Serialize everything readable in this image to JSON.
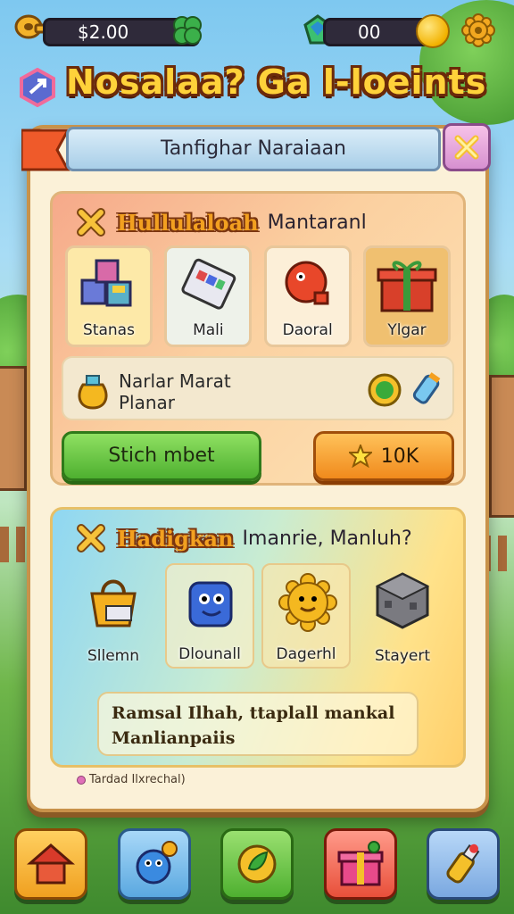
{
  "hud": {
    "currency_left": "$2.00",
    "currency_right": "00",
    "icons": [
      "key-icon",
      "clover-icon",
      "gem-icon",
      "coin-icon",
      "gear-icon"
    ]
  },
  "game_title": "Nosalaa? Ga l-loeints",
  "dialog": {
    "header": "Tanfighar Naraiaan",
    "section1": {
      "title_main": "Hullulaloah",
      "title_sub": "Mantaranl",
      "items": [
        {
          "label": "Stanas",
          "icon": "blocks-icon"
        },
        {
          "label": "Mali",
          "icon": "tablet-icon"
        },
        {
          "label": "Daoral",
          "icon": "creature-icon"
        },
        {
          "label": "Ylgar",
          "icon": "giftbox-icon"
        }
      ],
      "info_line1": "Narlar Marat",
      "info_line2": "Planar",
      "green_button": "Stich mbet",
      "orange_button": "10K"
    },
    "section2": {
      "title_main": "Hadigkan",
      "title_sub": "Imanrie, Manluh?",
      "items": [
        {
          "label": "Sllemn",
          "icon": "bag-icon"
        },
        {
          "label": "Dlounall",
          "icon": "blue-creature-icon"
        },
        {
          "label": "Dagerhl",
          "icon": "sun-creature-icon"
        },
        {
          "label": "Stayert",
          "icon": "stone-cube-icon"
        }
      ],
      "info_line1": "Ramsal Ilhah,  ttaplall mankal",
      "info_line2": "Manlianpaiis"
    },
    "footer_note": "Tardad Ilxrechal)"
  },
  "bottom_nav": [
    {
      "name": "house-icon"
    },
    {
      "name": "pet-icon"
    },
    {
      "name": "leaf-icon"
    },
    {
      "name": "gift-icon"
    },
    {
      "name": "potion-icon"
    }
  ],
  "colors": {
    "title_yellow": "#ffd23a",
    "dialog_bg": "#fbf1d8",
    "green_button": "#4eb030",
    "orange_button": "#f08a1c"
  }
}
